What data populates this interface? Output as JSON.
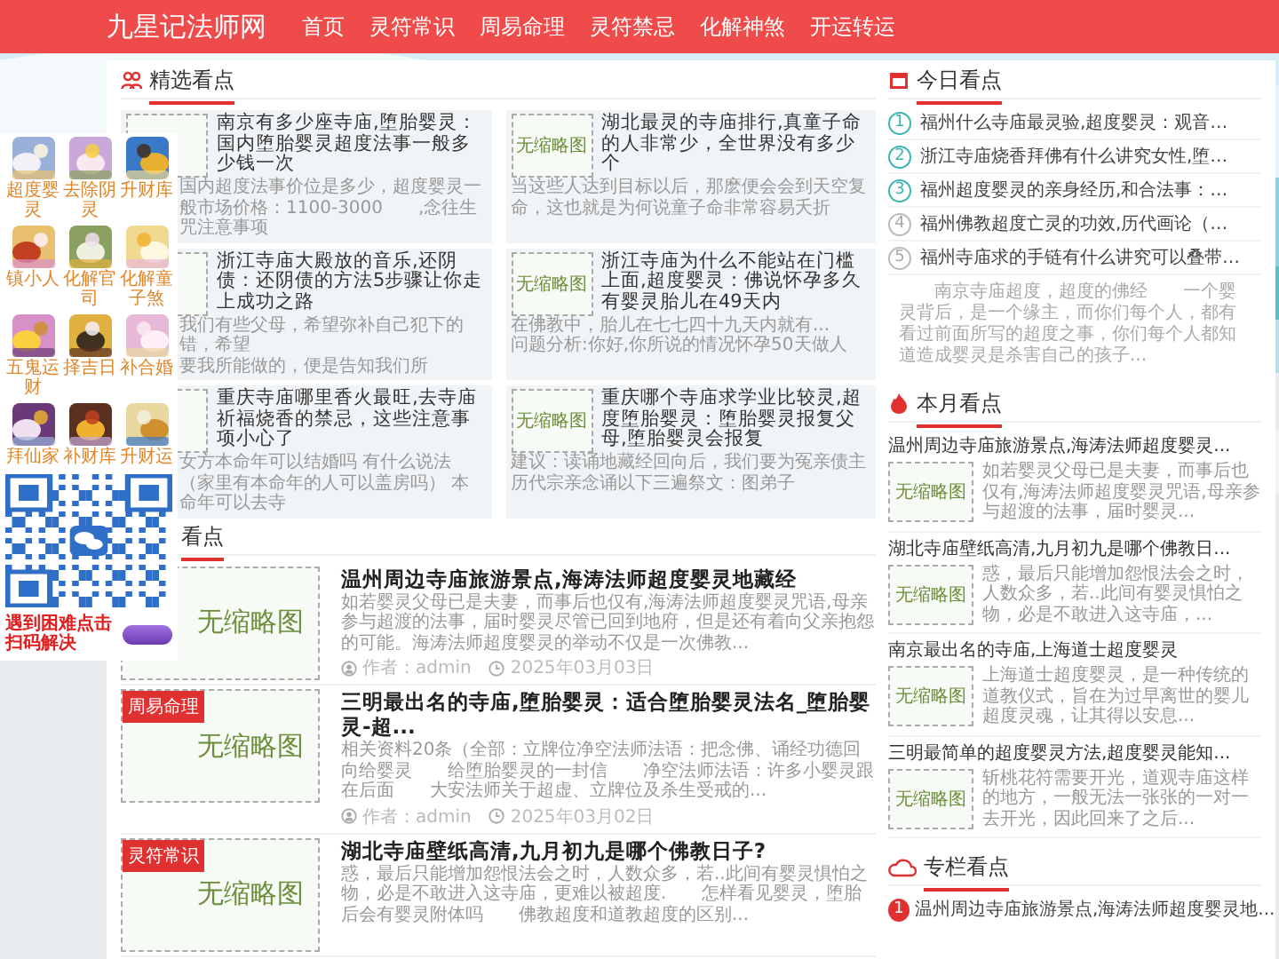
{
  "site": {
    "logo": "九星记法师网",
    "nav": [
      "首页",
      "灵符常识",
      "周易命理",
      "灵符禁忌",
      "化解神煞",
      "开运转运"
    ]
  },
  "apps": {
    "items": [
      {
        "label": "超度婴灵"
      },
      {
        "label": "去除阴灵"
      },
      {
        "label": "升财库"
      },
      {
        "label": "镇小人"
      },
      {
        "label": "化解官司"
      },
      {
        "label": "化解童子煞"
      },
      {
        "label": "五鬼运财"
      },
      {
        "label": "择吉日"
      },
      {
        "label": "补合婚"
      },
      {
        "label": "拜仙家"
      },
      {
        "label": "补财库"
      },
      {
        "label": "升财运"
      }
    ],
    "notice": "遇到困难点击扫码解决"
  },
  "featured": {
    "title": "精选看点",
    "items": [
      {
        "title": "南京有多少座寺庙,堕胎婴灵：国内堕胎婴灵超度法事一般多少钱一次",
        "excerpt": "国内超度法事价位是多少，超度婴灵一般市场价格：1100-3000　　,念往生咒注意事项"
      },
      {
        "thumb_text": "无缩略图",
        "title": "湖北最灵的寺庙排行,真童子命的人非常少，全世界没有多少个",
        "excerpt": "当这些人达到目标以后，那麽便会会到天空复命，这也就是为何说童子命非常容易夭折"
      },
      {
        "title": "浙江寺庙大殿放的音乐,还阴债：还阴债的方法5步骤让你走上成功之路",
        "excerpt": "我们有些父母，希望弥补自己犯下的错，希望",
        "overflow": "要我所能做的，便是告知我们所"
      },
      {
        "thumb_text": "无缩略图",
        "title": "浙江寺庙为什么不能站在门槛上面,超度婴灵：佛说怀孕多久有婴灵胎儿在49天内",
        "excerpt": "在佛教中，胎儿在七七四十九天内就有...",
        "overflow": "问题分析:你好,你所说的情况怀孕50天做人"
      },
      {
        "title": "重庆寺庙哪里香火最旺,去寺庙祈福烧香的禁忌，这些注意事项小心了",
        "excerpt": "女方本命年可以结婚吗 有什么说法（家里有本命年的人可以盖房吗） 本命年可以去寺"
      },
      {
        "thumb_text": "无缩略图",
        "title": "重庆哪个寺庙求学业比较灵,超度堕胎婴灵：堕胎婴灵报复父母,堕胎婴灵会报复",
        "excerpt": "建议：读诵地藏经回向后，我们要为冤亲债主",
        "overflow": "历代宗亲念诵以下三遍祭文：图弟子"
      }
    ]
  },
  "articles": {
    "title": "看点",
    "items": [
      {
        "thumb_text": "无缩略图",
        "title": "温州周边寺庙旅游景点,海涛法师超度婴灵地藏经",
        "excerpt": "如若婴灵父母已是夫妻，而事后也仅有,海涛法师超度婴灵咒语,母亲参与超渡的法事，届时婴灵尽管已回到地府，但是还有着向父亲抱怨的可能。海涛法师超度婴灵的举动不仅是一次佛教...",
        "author": "作者：admin",
        "date": "2025年03月03日"
      },
      {
        "tag": "周易命理",
        "thumb_text": "无缩略图",
        "title": "三明最出名的寺庙,堕胎婴灵：适合堕胎婴灵法名_堕胎婴灵-超...",
        "excerpt": "相关资料20条（全部：立牌位净空法师法语：把念佛、诵经功德回向给婴灵　　给堕胎婴灵的一封信　　净空法师法语：许多小婴灵跟在后面　　大安法师关于超虚、立牌位及杀生受戒的...",
        "author": "作者：admin",
        "date": "2025年03月02日"
      },
      {
        "tag": "灵符常识",
        "thumb_text": "无缩略图",
        "title": "湖北寺庙壁纸高清,九月初九是哪个佛教日子?",
        "excerpt": "惑，最后只能增加怨恨法会之时，人数众多，若..此间有婴灵惧怕之物，必是不敢进入这寺庙，更难以被超度.　　怎样看见婴灵，堕胎后会有婴灵附体吗　　佛教超度和道教超度的区别..."
      }
    ]
  },
  "today": {
    "title": "今日看点",
    "items": [
      {
        "rank": "1",
        "hot": true,
        "title": "福州什么寺庙最灵验,超度婴灵：观音…"
      },
      {
        "rank": "2",
        "hot": true,
        "title": "浙江寺庙烧香拜佛有什么讲究女性,堕…"
      },
      {
        "rank": "3",
        "hot": true,
        "title": "福州超度婴灵的亲身经历,和合法事：…"
      },
      {
        "rank": "4",
        "hot": false,
        "title": "福州佛教超度亡灵的功效,历代画论（…"
      },
      {
        "rank": "5",
        "hot": false,
        "title": "福州寺庙求的手链有什么讲究可以叠带…"
      }
    ],
    "summary": "南京寺庙超度，超度的佛经　　一个婴灵背后，是一个缘主，而你们每个人，都有看过前面所写的超度之事，你们每个人都知道造成婴灵是杀害自己的孩子..."
  },
  "month": {
    "title": "本月看点",
    "items": [
      {
        "title": "温州周边寺庙旅游景点,海涛法师超度婴灵...",
        "thumb_text": "无缩略图",
        "excerpt": "如若婴灵父母已是夫妻，而事后也仅有,海涛法师超度婴灵咒语,母亲参与超渡的法事，届时婴灵..."
      },
      {
        "title": "湖北寺庙壁纸高清,九月初九是哪个佛教日...",
        "thumb_text": "无缩略图",
        "excerpt": "惑，最后只能增加怨恨法会之时，人数众多，若..此间有婴灵惧怕之物，必是不敢进入这寺庙，..."
      },
      {
        "title": "南京最出名的寺庙,上海道士超度婴灵",
        "thumb_text": "无缩略图",
        "excerpt": "上海道士超度婴灵，是一种传统的道教仪式，旨在为过早离世的婴儿超度灵魂，让其得以安息..."
      },
      {
        "title": "三明最简单的超度婴灵方法,超度婴灵能知...",
        "thumb_text": "无缩略图",
        "excerpt": "斩桃花符需要开光，道观寺庙这样的地方，一般无法一张张的一对一去开光，因此回来了之后..."
      }
    ]
  },
  "column": {
    "title": "专栏看点",
    "items": [
      {
        "rank": "1",
        "title": "温州周边寺庙旅游景点,海涛法师超度婴灵地..."
      }
    ]
  }
}
